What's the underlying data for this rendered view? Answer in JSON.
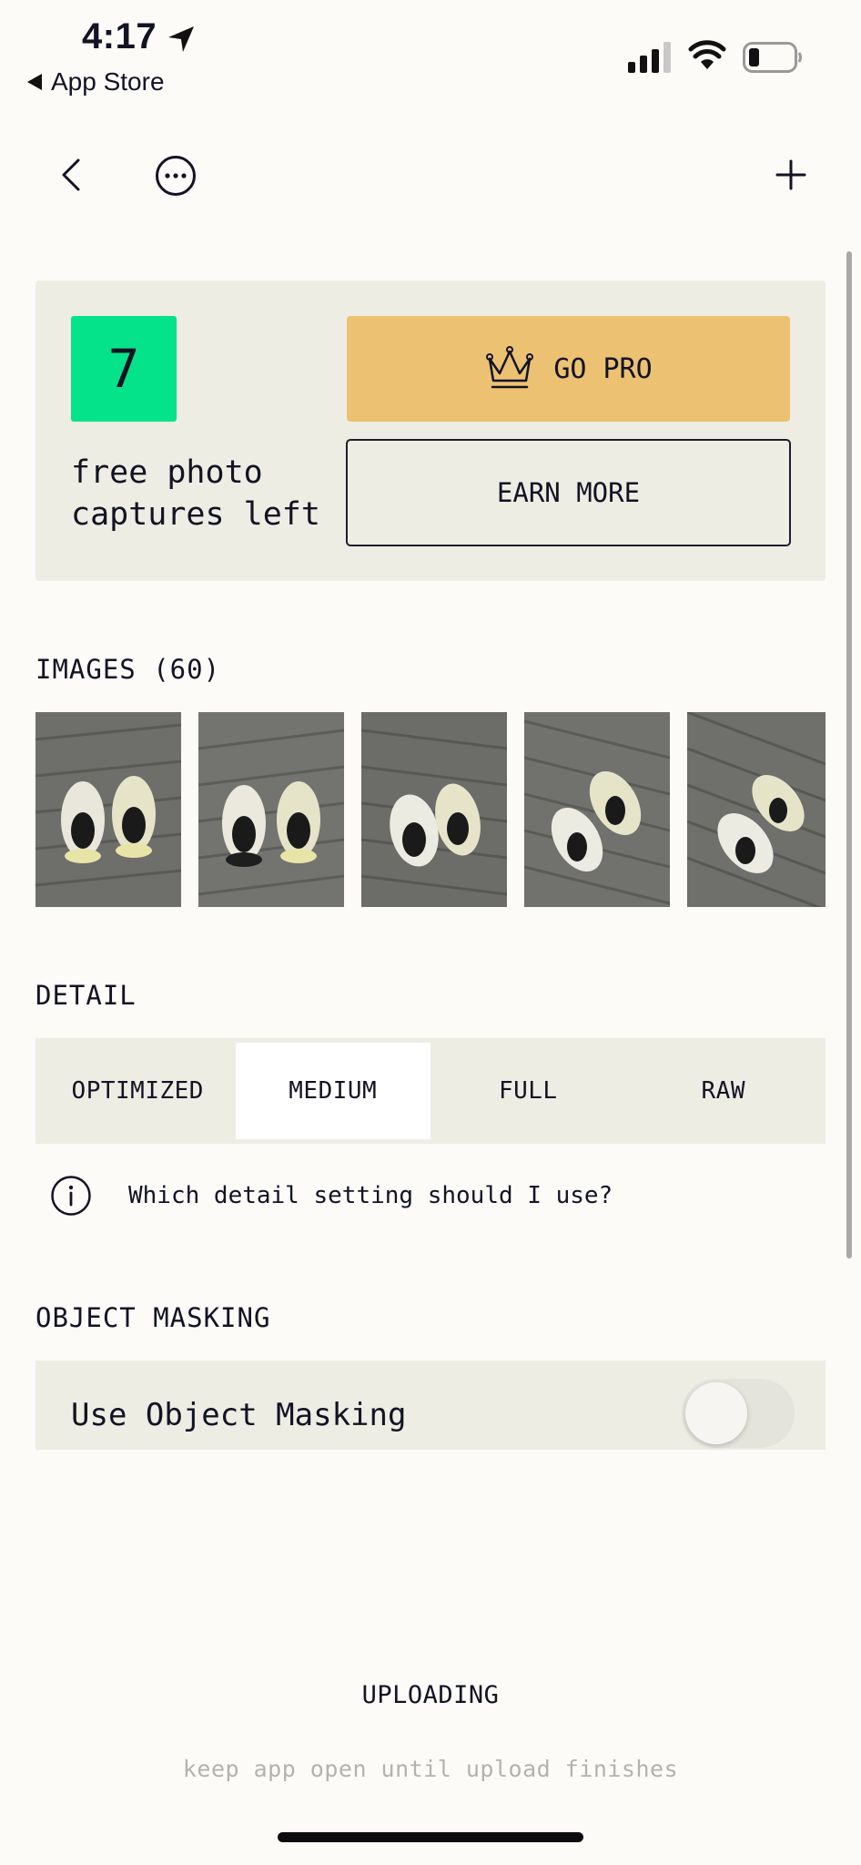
{
  "status_bar": {
    "time": "4:17",
    "back_app_label": "App Store",
    "icons": [
      "location-arrow-icon",
      "cellular-signal-icon",
      "wifi-icon",
      "battery-icon"
    ]
  },
  "nav": {
    "icons": [
      "chevron-left-icon",
      "more-circle-icon",
      "plus-icon"
    ]
  },
  "pro_card": {
    "count": "7",
    "captures_text": "free photo\ncaptures left",
    "go_pro_label": "GO PRO",
    "earn_more_label": "EARN MORE",
    "colors": {
      "count_bg": "#05e38a",
      "go_pro_bg": "#ecc171",
      "card_bg": "#eeede4"
    }
  },
  "images": {
    "label": "IMAGES (60)",
    "thumbnails": [
      "shoes-photo",
      "shoes-photo",
      "shoes-photo",
      "shoes-photo",
      "shoes-photo"
    ]
  },
  "detail": {
    "label": "DETAIL",
    "options": [
      "OPTIMIZED",
      "MEDIUM",
      "FULL",
      "RAW"
    ],
    "selected": "MEDIUM",
    "help_text": "Which detail setting should I use?",
    "help_icon": "info-circle-icon"
  },
  "object_masking": {
    "label": "OBJECT MASKING",
    "toggle_label": "Use Object Masking",
    "enabled": false
  },
  "footer": {
    "status": "UPLOADING",
    "hint": "keep app open until upload finishes"
  }
}
